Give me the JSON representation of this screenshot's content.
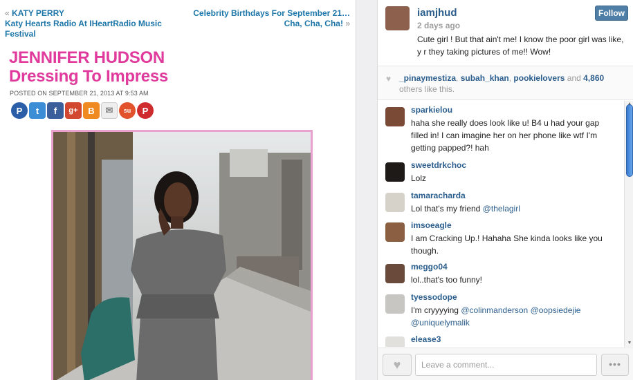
{
  "blog": {
    "prev_quote": "«",
    "prev_category": "KATY PERRY",
    "prev_title": "Katy Hearts Radio At IHeartRadio Music Festival",
    "next_title": "Celebrity Birthdays For September 21… Cha, Cha, Cha!",
    "next_quote": "»",
    "title_line1": "JENNIFER HUDSON",
    "title_line2": "Dressing To Impress",
    "posted": "POSTED ON SEPTEMBER 21, 2013 AT 9:53 AM",
    "share_icons": [
      "pinterest-icon",
      "twitter-icon",
      "facebook-icon",
      "google-plus-icon",
      "blogger-icon",
      "email-icon",
      "stumbleupon-icon",
      "pinterest-icon"
    ],
    "share_glyphs": {
      "pin": "P",
      "tw": "t",
      "fb": "f",
      "gp": "g+",
      "bl": "B",
      "em": "✉",
      "su": "su"
    }
  },
  "instagram": {
    "username": "iamjhud",
    "time_ago": "2 days ago",
    "caption": "Cute girl ! But that ain't me! I know the poor girl was like, y r they taking pictures of me!! Wow!",
    "follow_label": "Follow",
    "likes": {
      "heart": "♥",
      "likers": [
        "_pinaymestiza",
        "subah_khan",
        "pookielovers"
      ],
      "and": "and",
      "count": "4,860",
      "suffix": "others like this."
    },
    "comments": [
      {
        "user": "sparkielou",
        "text": "haha she really does look like u! B4 u had your gap filled in! I can imagine her on her phone like wtf I'm getting papped?! hah"
      },
      {
        "user": "sweetdrkchoc",
        "text": "Lolz"
      },
      {
        "user": "tamaracharda",
        "text_before": "Lol that's my friend ",
        "mention": "@thelagirl"
      },
      {
        "user": "imsoeagle",
        "text": "I am Cracking Up.! Hahaha She kinda looks like you though."
      },
      {
        "user": "meggo04",
        "text": "lol..that's too funny!"
      },
      {
        "user": "tyessodope",
        "text_before": "I'm cryyyying ",
        "mentions": [
          "@colinmanderson",
          "@oopsiedejie",
          "@uniquelymalik"
        ]
      },
      {
        "user": "elease3",
        "text": ""
      }
    ],
    "comment_placeholder": "Leave a comment...",
    "like_icon": "♥",
    "more_label": "•••",
    "scroll_up": "▲",
    "scroll_down": "▼"
  }
}
